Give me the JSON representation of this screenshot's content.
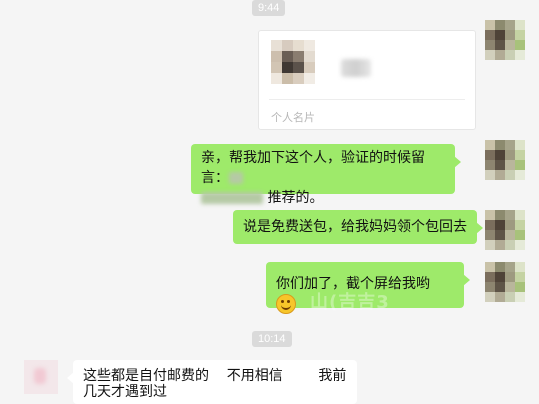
{
  "timestamps": [
    "9:44",
    "10:14"
  ],
  "card": {
    "label": "个人名片"
  },
  "messages": [
    {
      "text_a": "亲，帮我加下这个人，验证的时候留言：",
      "text_b": "推荐的。"
    },
    {
      "text": "说是免费送包，给我妈妈领个包回去"
    },
    {
      "text": "你们加了，截个屏给我哟",
      "emoji": "smile-emoji"
    }
  ],
  "incoming": {
    "line1": "这些都是自付邮费的    不用相信        我前",
    "line2": "几天才遇到过"
  },
  "watermark": "山(吉吉3",
  "colors": {
    "outgoing": "#9eea6a",
    "incoming": "#ffffff",
    "background": "#f5f5f5"
  }
}
